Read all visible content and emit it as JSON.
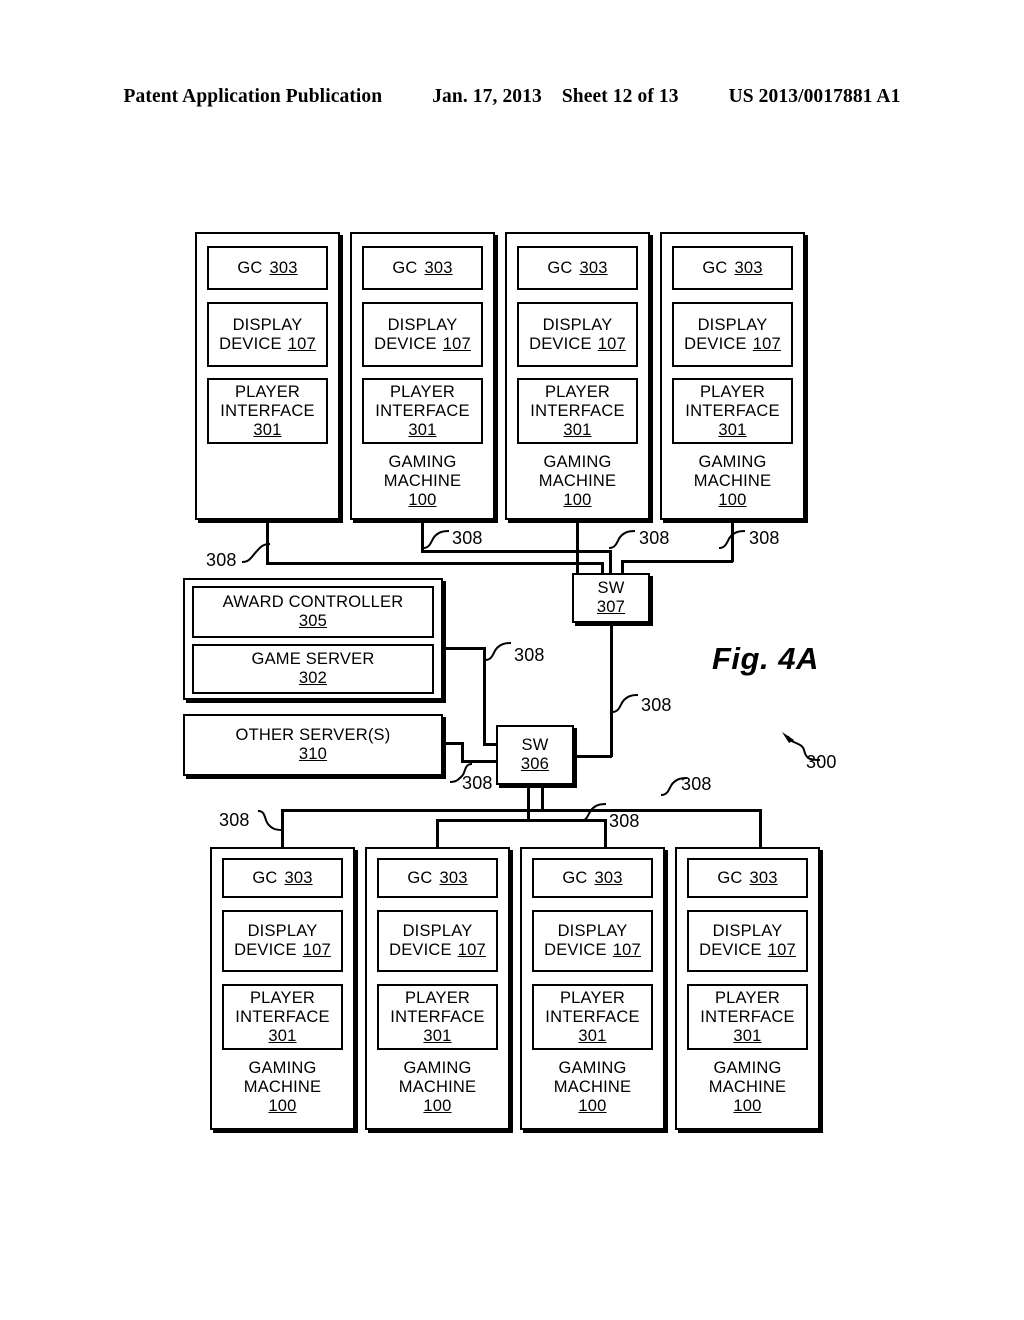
{
  "header": {
    "publication": "Patent Application Publication",
    "date": "Jan. 17, 2013",
    "sheet": "Sheet 12 of 13",
    "doc_number": "US 2013/0017881 A1"
  },
  "figure": {
    "caption": "Fig. 4A",
    "system_ref": "300",
    "link_ref": "308"
  },
  "labels": {
    "gc": "GC",
    "gc_num": "303",
    "display_device_l1": "DISPLAY",
    "display_device_l2": "DEVICE",
    "display_device_num": "107",
    "player_interface_l1": "PLAYER",
    "player_interface_l2": "INTERFACE",
    "player_interface_num": "301",
    "gaming_machine_l1": "GAMING",
    "gaming_machine_l2": "MACHINE",
    "gaming_machine_num": "100"
  },
  "servers": {
    "award_controller": "AWARD CONTROLLER",
    "award_controller_num": "305",
    "game_server": "GAME SERVER",
    "game_server_num": "302",
    "other_servers": "OTHER SERVER(S)",
    "other_servers_num": "310"
  },
  "switches": {
    "sw_top": "SW",
    "sw_top_num": "307",
    "sw_bottom": "SW",
    "sw_bottom_num": "306"
  },
  "top_machines": [
    {
      "has_machine_label": false
    },
    {
      "has_machine_label": true
    },
    {
      "has_machine_label": true
    },
    {
      "has_machine_label": true
    }
  ],
  "bottom_machines": [
    {
      "has_machine_label": true
    },
    {
      "has_machine_label": true
    },
    {
      "has_machine_label": true
    },
    {
      "has_machine_label": true
    }
  ],
  "link_refs": [
    {
      "id": "top-left",
      "value": "308"
    },
    {
      "id": "top-mid",
      "value": "308"
    },
    {
      "id": "top-right",
      "value": "308"
    },
    {
      "id": "top-far-right",
      "value": "308"
    },
    {
      "id": "server-sw",
      "value": "308"
    },
    {
      "id": "sw307-sw306",
      "value": "308"
    },
    {
      "id": "other-sw",
      "value": "308"
    },
    {
      "id": "bot-far-left",
      "value": "308"
    },
    {
      "id": "bot-left",
      "value": "308"
    },
    {
      "id": "bot-mid",
      "value": "308"
    },
    {
      "id": "bot-right",
      "value": "308"
    }
  ],
  "colors": {
    "ink": "#000000",
    "paper": "#ffffff"
  }
}
